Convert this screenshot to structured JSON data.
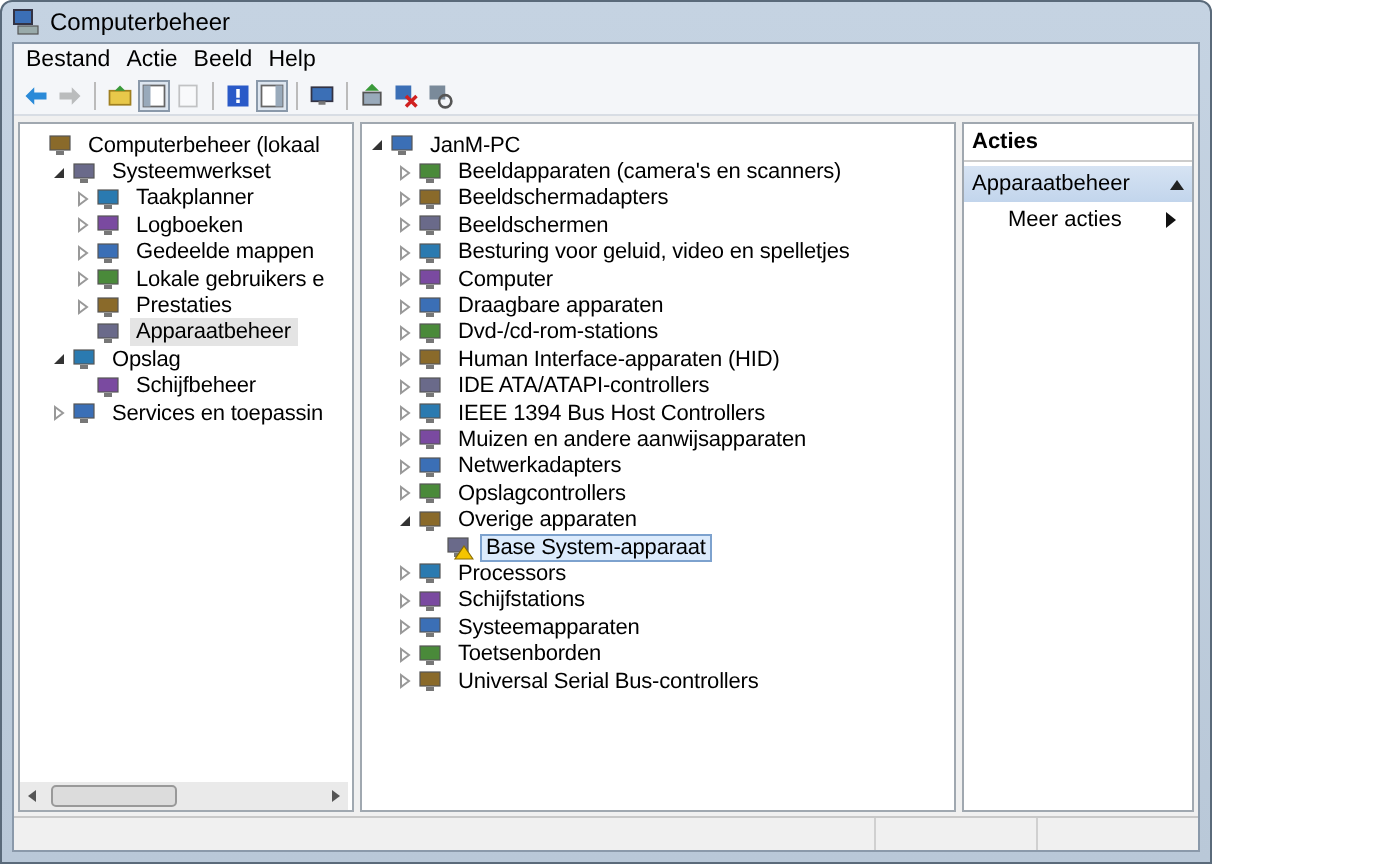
{
  "window": {
    "title": "Computerbeheer"
  },
  "menu": [
    "Bestand",
    "Actie",
    "Beeld",
    "Help"
  ],
  "toolbar": [
    {
      "pressed": false,
      "disabled": false
    },
    {
      "pressed": false,
      "disabled": true
    },
    {
      "pressed": false,
      "disabled": false
    },
    {
      "pressed": true,
      "disabled": false
    },
    {
      "pressed": false,
      "disabled": true
    },
    {
      "pressed": false,
      "disabled": false
    },
    {
      "pressed": true,
      "disabled": false
    },
    {
      "pressed": false,
      "disabled": false
    },
    {
      "pressed": false,
      "disabled": false
    },
    {
      "pressed": false,
      "disabled": false
    },
    {
      "pressed": false,
      "disabled": false
    }
  ],
  "console_tree": [
    {
      "label": "Computerbeheer (lokaal",
      "selected": false,
      "children": [
        {
          "label": "Systeemwerkset",
          "expanded": true,
          "selected": false,
          "children": [
            {
              "label": "Taakplanner",
              "expanded": false,
              "selected": false
            },
            {
              "label": "Logboeken",
              "expanded": false,
              "selected": false
            },
            {
              "label": "Gedeelde mappen",
              "expanded": false,
              "selected": false
            },
            {
              "label": "Lokale gebruikers e",
              "expanded": false,
              "selected": false
            },
            {
              "label": "Prestaties",
              "expanded": false,
              "selected": false
            },
            {
              "label": "Apparaatbeheer",
              "selected": true
            }
          ]
        },
        {
          "label": "Opslag",
          "expanded": true,
          "selected": false,
          "children": [
            {
              "label": "Schijfbeheer",
              "selected": false
            }
          ]
        },
        {
          "label": "Services en toepassin",
          "expanded": false,
          "selected": false
        }
      ]
    }
  ],
  "device_tree": [
    {
      "label": "JanM-PC",
      "expanded": true,
      "selected": false,
      "warning": false,
      "children": [
        {
          "label": "Beeldapparaten (camera's en scanners)",
          "expanded": false,
          "selected": false,
          "warning": false
        },
        {
          "label": "Beeldschermadapters",
          "expanded": false,
          "selected": false,
          "warning": false
        },
        {
          "label": "Beeldschermen",
          "expanded": false,
          "selected": false,
          "warning": false
        },
        {
          "label": "Besturing voor geluid, video en spelletjes",
          "expanded": false,
          "selected": false,
          "warning": false
        },
        {
          "label": "Computer",
          "expanded": false,
          "selected": false,
          "warning": false
        },
        {
          "label": "Draagbare apparaten",
          "expanded": false,
          "selected": false,
          "warning": false
        },
        {
          "label": "Dvd-/cd-rom-stations",
          "expanded": false,
          "selected": false,
          "warning": false
        },
        {
          "label": "Human Interface-apparaten (HID)",
          "expanded": false,
          "selected": false,
          "warning": false
        },
        {
          "label": "IDE ATA/ATAPI-controllers",
          "expanded": false,
          "selected": false,
          "warning": false
        },
        {
          "label": "IEEE 1394 Bus Host Controllers",
          "expanded": false,
          "selected": false,
          "warning": false
        },
        {
          "label": "Muizen en andere aanwijsapparaten",
          "expanded": false,
          "selected": false,
          "warning": false
        },
        {
          "label": "Netwerkadapters",
          "expanded": false,
          "selected": false,
          "warning": false
        },
        {
          "label": "Opslagcontrollers",
          "expanded": false,
          "selected": false,
          "warning": false
        },
        {
          "label": "Overige apparaten",
          "expanded": true,
          "selected": false,
          "warning": false,
          "children": [
            {
              "label": "Base System-apparaat",
              "selected": true,
              "warning": true
            }
          ]
        },
        {
          "label": "Processors",
          "expanded": false,
          "selected": false,
          "warning": false
        },
        {
          "label": "Schijfstations",
          "expanded": false,
          "selected": false,
          "warning": false
        },
        {
          "label": "Systeemapparaten",
          "expanded": false,
          "selected": false,
          "warning": false
        },
        {
          "label": "Toetsenborden",
          "expanded": false,
          "selected": false,
          "warning": false
        },
        {
          "label": "Universal Serial Bus-controllers",
          "expanded": false,
          "selected": false,
          "warning": false
        }
      ]
    }
  ],
  "actions": {
    "title": "Acties",
    "sections": [
      {
        "title": "Apparaatbeheer",
        "expanded": true,
        "items": [
          "Meer acties"
        ]
      }
    ]
  }
}
